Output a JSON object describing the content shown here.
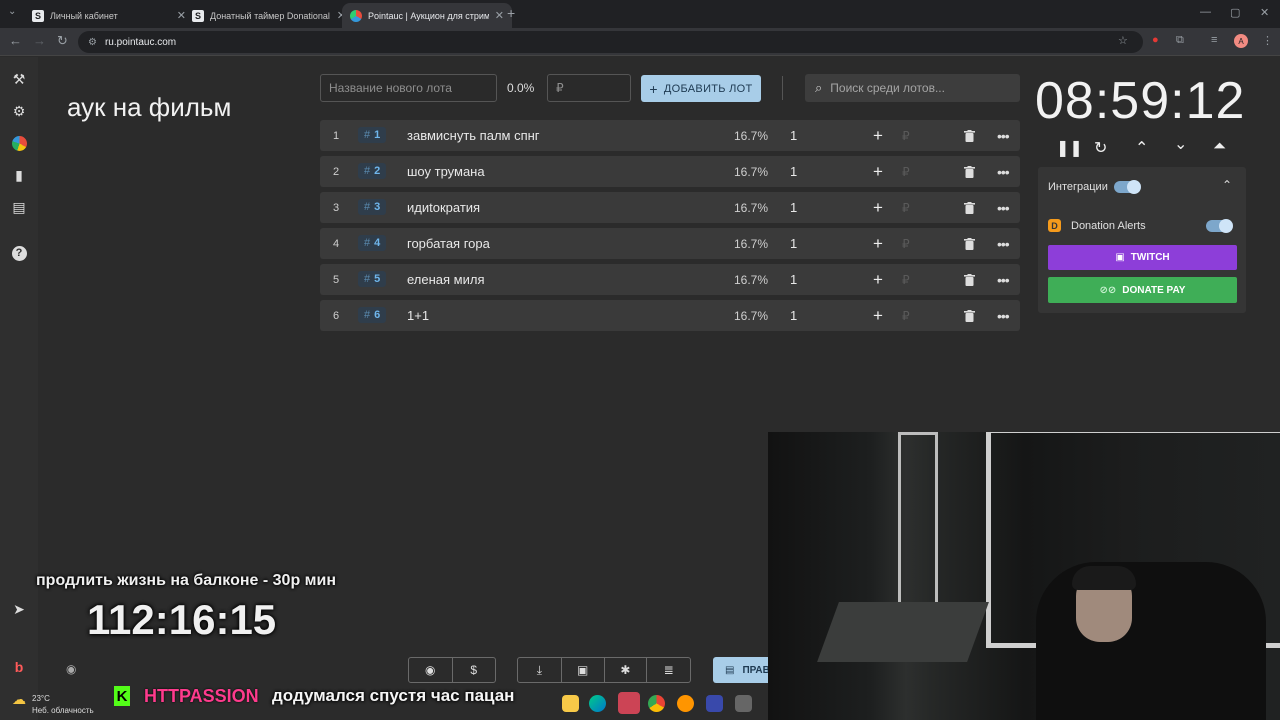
{
  "browser": {
    "tabs": [
      {
        "favicon": "S",
        "title": "Личный кабинет"
      },
      {
        "favicon": "S",
        "title": "Донатный таймер Donational"
      },
      {
        "favicon": "",
        "title": "Pointauc | Аукцион для стрима"
      }
    ],
    "url": "ru.pointauc.com",
    "profile_initial": "A"
  },
  "app": {
    "title": "аук на фильм",
    "new_lot": {
      "name_placeholder": "Название нового лота",
      "percent": "0.0%",
      "amount_placeholder": "₽",
      "add_label": "ДОБАВИТЬ ЛОТ"
    },
    "search_placeholder": "Поиск среди лотов...",
    "lots": [
      {
        "index": "1",
        "id": "1",
        "name": "завмиснуть палм спнг",
        "percent": "16.7%",
        "amount": "1"
      },
      {
        "index": "2",
        "id": "2",
        "name": "шоу трумана",
        "percent": "16.7%",
        "amount": "1"
      },
      {
        "index": "3",
        "id": "3",
        "name": "идиtoкратия",
        "percent": "16.7%",
        "amount": "1"
      },
      {
        "index": "4",
        "id": "4",
        "name": "горбатая гора",
        "percent": "16.7%",
        "amount": "1"
      },
      {
        "index": "5",
        "id": "5",
        "name": "еленая миля",
        "percent": "16.7%",
        "amount": "1"
      },
      {
        "index": "6",
        "id": "6",
        "name": "1+1",
        "percent": "16.7%",
        "amount": "1"
      }
    ],
    "timer": "08:59:12",
    "integrations": {
      "label": "Интеграции",
      "donation_alerts": "Donation Alerts",
      "twitch": "TWITCH",
      "donatepay": "DONATE PAY"
    },
    "rules_label": "ПРАВ"
  },
  "stream": {
    "caption": "продлить жизнь на балконе - 30р мин",
    "countdown": "112:16:15",
    "chat_user": "HTTPASSION",
    "chat_message": "додумался спустя час пацан"
  },
  "taskbar": {
    "temperature": "23°C",
    "weather": "Неб. облачность"
  }
}
